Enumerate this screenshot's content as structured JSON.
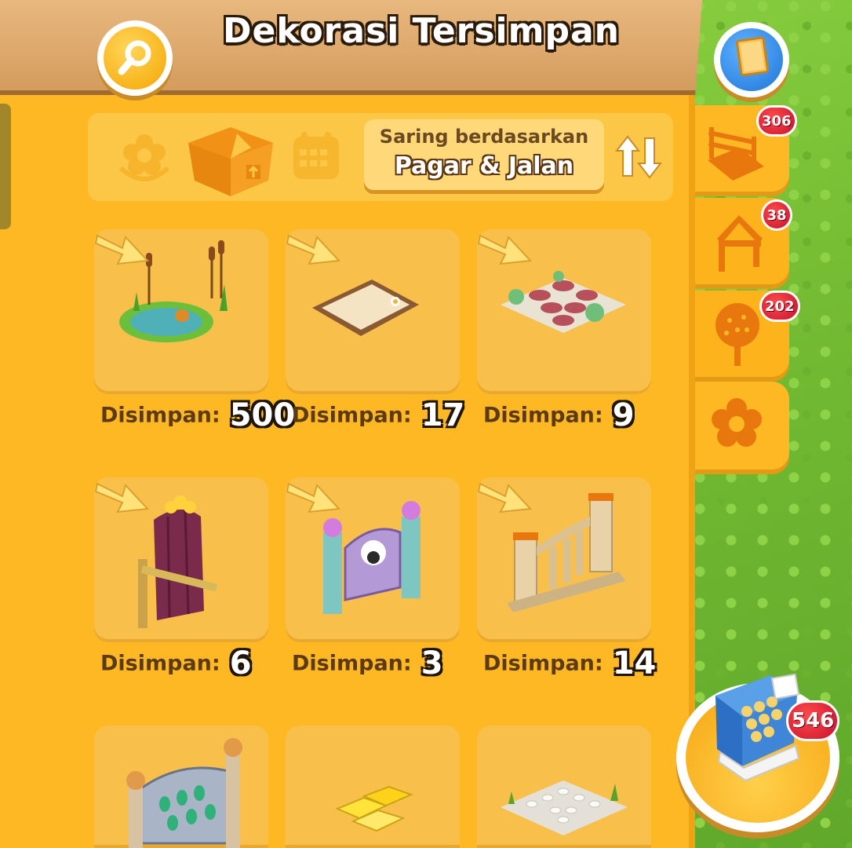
{
  "header": {
    "title": "Dekorasi Tersimpan"
  },
  "icons": {
    "search": "search-icon",
    "book": "album-icon"
  },
  "filter": {
    "caption": "Saring berdasarkan",
    "value": "Pagar & Jalan",
    "tabs": [
      "flower-icon",
      "box-icon",
      "calendar-icon"
    ]
  },
  "items": [
    {
      "name": "pond",
      "label": "Disimpan:",
      "count": "500"
    },
    {
      "name": "sandbox",
      "label": "Disimpan:",
      "count": "17"
    },
    {
      "name": "garden-path",
      "label": "Disimpan:",
      "count": "9"
    },
    {
      "name": "purple-gate",
      "label": "Disimpan:",
      "count": "6"
    },
    {
      "name": "sheep-gate",
      "label": "Disimpan:",
      "count": "3"
    },
    {
      "name": "column-fence",
      "label": "Disimpan:",
      "count": "14"
    },
    {
      "name": "gem-arch",
      "label": "",
      "count": ""
    },
    {
      "name": "gold-path",
      "label": "",
      "count": ""
    },
    {
      "name": "pebble-path",
      "label": "",
      "count": ""
    }
  ],
  "side_tabs": [
    {
      "icon": "fence-icon",
      "badge": "306"
    },
    {
      "icon": "shelter-icon",
      "badge": "38"
    },
    {
      "icon": "tree-icon",
      "badge": "202"
    },
    {
      "icon": "flower-icon",
      "badge": ""
    }
  ],
  "shop": {
    "icon": "cash-register-icon",
    "badge": "546"
  },
  "colors": {
    "panel": "#fdb824",
    "tile": "#f8c04a",
    "wood": "#d49c5e",
    "badge": "#c8102e",
    "grass": "#7fc43a"
  }
}
